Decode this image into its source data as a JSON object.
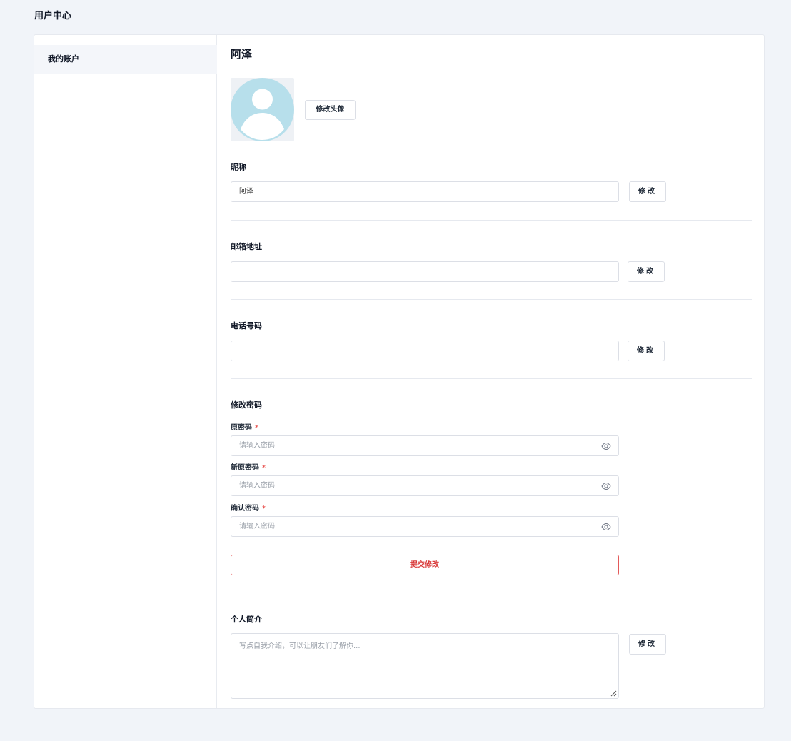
{
  "page": {
    "title": "用户中心"
  },
  "sidebar": {
    "items": [
      {
        "label": "我的账户"
      }
    ]
  },
  "profile": {
    "name": "阿泽",
    "avatar_button": "修改头像",
    "avatar_icon": "user-avatar-icon"
  },
  "nickname": {
    "label": "昵称",
    "value": "阿泽",
    "button": "修改"
  },
  "email": {
    "label": "邮箱地址",
    "value": "",
    "button": "修改"
  },
  "phone": {
    "label": "电话号码",
    "value": "",
    "button": "修改"
  },
  "password": {
    "section_label": "修改密码",
    "required_mark": "*",
    "fields": [
      {
        "label": "原密码",
        "placeholder": "请输入密码"
      },
      {
        "label": "新原密码",
        "placeholder": "请输入密码"
      },
      {
        "label": "确认密码",
        "placeholder": "请输入密码"
      }
    ],
    "submit_button": "提交修改"
  },
  "bio": {
    "label": "个人简介",
    "placeholder": "写点自我介绍，可以让朋友们了解你...",
    "button": "修改"
  },
  "colors": {
    "accent_red": "#d93a3a",
    "avatar_blue": "#b7dfeb",
    "background": "#f1f4f9"
  }
}
